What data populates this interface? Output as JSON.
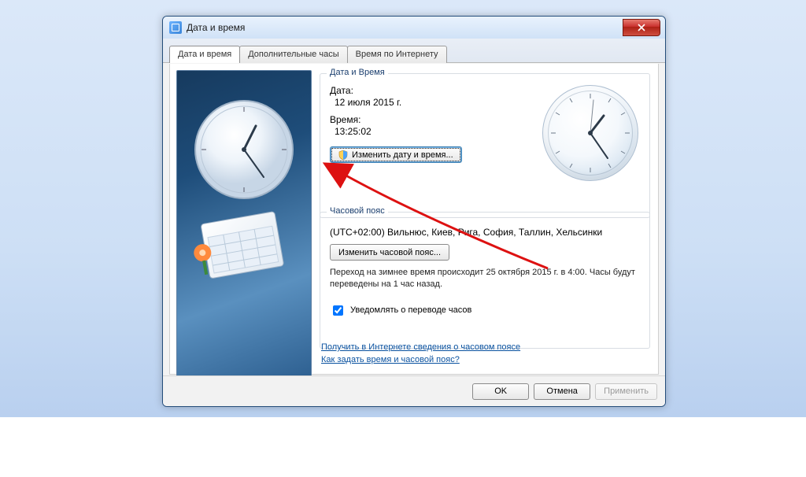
{
  "window": {
    "title": "Дата и время"
  },
  "tabs": {
    "datetime": "Дата и время",
    "additional": "Дополнительные часы",
    "internet": "Время по Интернету"
  },
  "dt_group": {
    "title": "Дата и Время",
    "date_label": "Дата:",
    "date_value": "12 июля 2015 г.",
    "time_label": "Время:",
    "time_value": "13:25:02",
    "change_btn": "Изменить дату и время..."
  },
  "tz_group": {
    "title": "Часовой пояс",
    "tz_value": "(UTC+02:00) Вильнюс, Киев, Рига, София, Таллин, Хельсинки",
    "change_btn": "Изменить часовой пояс...",
    "dst_note": "Переход на зимнее время происходит 25 октября 2015 г. в 4:00. Часы будут переведены на 1 час назад.",
    "notify_label": "Уведомлять о переводе часов",
    "notify_checked": true
  },
  "links": {
    "learn_tz": "Получить в Интернете сведения о часовом поясе",
    "howto": "Как задать время и часовой пояс?"
  },
  "footer": {
    "ok": "OK",
    "cancel": "Отмена",
    "apply": "Применить"
  },
  "clock": {
    "hour_angle": 42.5,
    "minute_angle": 150,
    "second_angle": 12
  }
}
